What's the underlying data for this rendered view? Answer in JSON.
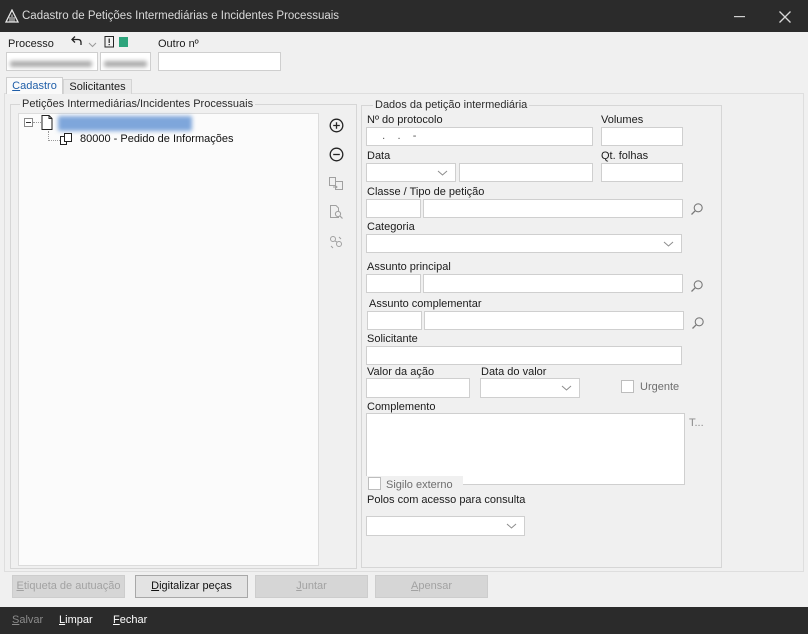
{
  "window": {
    "title": "Cadastro de Petições Intermediárias e Incidentes Processuais"
  },
  "header": {
    "processo_label": "Processo",
    "outro_label": "Outro nº"
  },
  "tabs": [
    {
      "label": "Cadastro",
      "active": true
    },
    {
      "label": "Solicitantes",
      "active": false
    }
  ],
  "tree_panel": {
    "title": "Petições Intermediárias/Incidentes Processuais",
    "child_item_label": "80000 - Pedido de Informações"
  },
  "form": {
    "title": "Dados da petição intermediária",
    "protocolo": {
      "label": "Nº do protocolo",
      "value": "   .    .    -"
    },
    "volumes": {
      "label": "Volumes"
    },
    "data": {
      "label": "Data",
      "value": " / /"
    },
    "qt_folhas": {
      "label": "Qt. folhas"
    },
    "classe_tipo": {
      "label": "Classe / Tipo de petição"
    },
    "categoria": {
      "label": "Categoria"
    },
    "assunto_principal": {
      "label": "Assunto principal"
    },
    "assunto_complementar": {
      "label": "Assunto complementar"
    },
    "solicitante": {
      "label": "Solicitante"
    },
    "valor_acao": {
      "label": "Valor da ação"
    },
    "data_valor": {
      "label": "Data do valor",
      "value": " / /"
    },
    "urgente": {
      "label": "Urgente",
      "checked": false
    },
    "complemento": {
      "label": "Complemento",
      "side_button_label": "T..."
    },
    "sigilo_externo": {
      "label": "Sigilo externo",
      "checked": false
    },
    "polos": {
      "label": "Polos com acesso para consulta"
    }
  },
  "actions": {
    "etiqueta": {
      "label": "Etiqueta de autuação",
      "enabled": false
    },
    "digitalizar": {
      "label": "Digitalizar peças",
      "enabled": true
    },
    "juntar": {
      "label": "Juntar",
      "enabled": false
    },
    "apensar": {
      "label": "Apensar",
      "enabled": false
    }
  },
  "footer": {
    "salvar": {
      "label": "Salvar",
      "enabled": false
    },
    "limpar": {
      "label": "Limpar",
      "enabled": true
    },
    "fechar": {
      "label": "Fechar",
      "enabled": true
    }
  },
  "icons": {
    "app": "app-logo-icon",
    "undo": "undo-icon",
    "add": "add-circle-icon",
    "remove": "remove-circle-icon",
    "copy": "copy-document-icon",
    "find_document": "document-search-icon",
    "link": "link-icon",
    "search": "search-icon",
    "dropdown": "chevron-down-icon"
  },
  "colors": {
    "title_bar": "#2b2b2b",
    "footer_bar": "#2b2b2b",
    "status_green": "#2ea47c",
    "active_tab_text": "#1f5ea8",
    "tree_selection": "#7ea6db"
  }
}
